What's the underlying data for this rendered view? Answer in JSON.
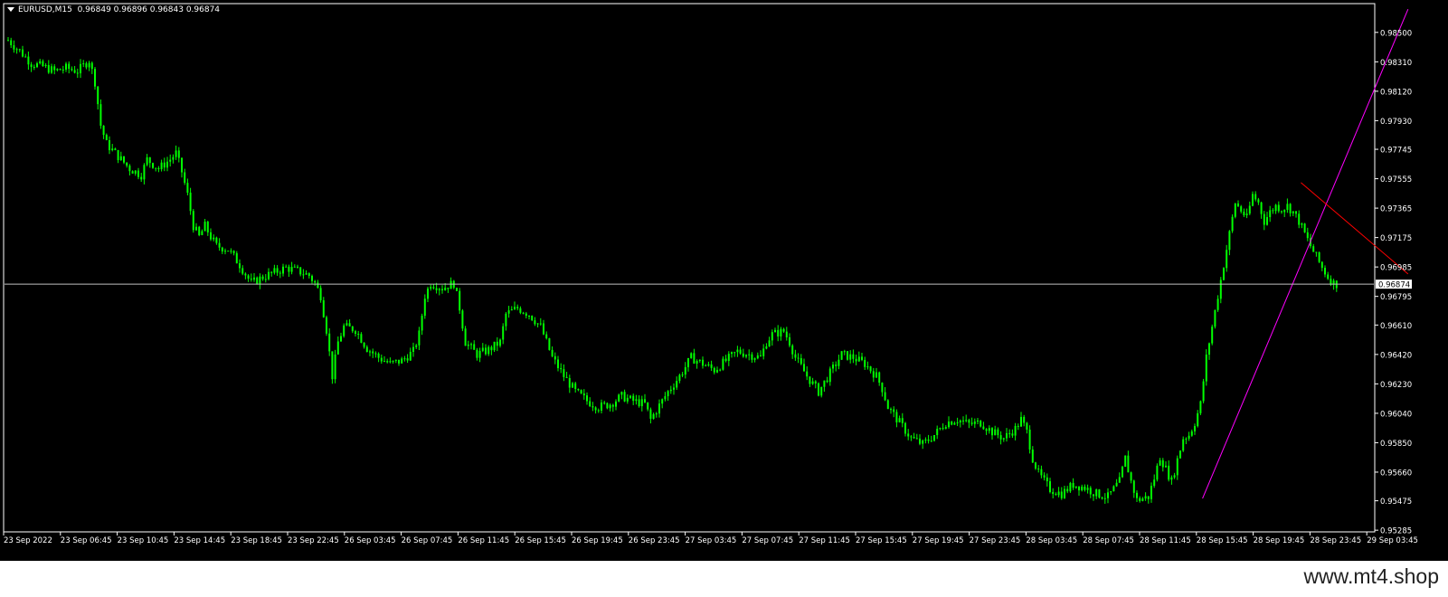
{
  "header": {
    "symbol": "EURUSD,M15",
    "ohlc": "0.96849 0.96896 0.96843 0.96874"
  },
  "watermark": "www.mt4.shop",
  "colors": {
    "background": "#000000",
    "candles": "#00ff00",
    "axis": "#ffffff",
    "price_line": "#c0c0c0",
    "trendline_up": "#ff00ff",
    "trendline_down": "#ff0000"
  },
  "chart_data": {
    "type": "line",
    "symbol": "EURUSD",
    "timeframe": "M15",
    "current_price": 0.96874,
    "current_price_label": "0.96874",
    "grid": false,
    "ylim": [
      0.9528,
      0.9868
    ],
    "y_ticks": [
      "0.98500",
      "0.98310",
      "0.98120",
      "0.97930",
      "0.97745",
      "0.97555",
      "0.97365",
      "0.97175",
      "0.96985",
      "0.96795",
      "0.96610",
      "0.96420",
      "0.96230",
      "0.96040",
      "0.95850",
      "0.95660",
      "0.95475",
      "0.95285"
    ],
    "x_ticks": [
      "23 Sep 2022",
      "23 Sep 06:45",
      "23 Sep 10:45",
      "23 Sep 14:45",
      "23 Sep 18:45",
      "23 Sep 22:45",
      "26 Sep 03:45",
      "26 Sep 07:45",
      "26 Sep 11:45",
      "26 Sep 15:45",
      "26 Sep 19:45",
      "26 Sep 23:45",
      "27 Sep 03:45",
      "27 Sep 07:45",
      "27 Sep 11:45",
      "27 Sep 15:45",
      "27 Sep 19:45",
      "27 Sep 23:45",
      "28 Sep 03:45",
      "28 Sep 07:45",
      "28 Sep 11:45",
      "28 Sep 15:45",
      "28 Sep 19:45",
      "28 Sep 23:45",
      "29 Sep 03:45"
    ],
    "series": [
      {
        "values": [
          [
            0,
            0.9845
          ],
          [
            4,
            0.9838
          ],
          [
            8,
            0.983
          ],
          [
            12,
            0.9828
          ],
          [
            16,
            0.9825
          ],
          [
            20,
            0.9827
          ],
          [
            24,
            0.9825
          ],
          [
            28,
            0.9832
          ],
          [
            30,
            0.9818
          ],
          [
            32,
            0.979
          ],
          [
            34,
            0.9778
          ],
          [
            38,
            0.977
          ],
          [
            42,
            0.9762
          ],
          [
            46,
            0.9758
          ],
          [
            48,
            0.9768
          ],
          [
            52,
            0.9762
          ],
          [
            56,
            0.9768
          ],
          [
            58,
            0.9772
          ],
          [
            60,
            0.976
          ],
          [
            62,
            0.9745
          ],
          [
            64,
            0.9725
          ],
          [
            66,
            0.9718
          ],
          [
            68,
            0.9725
          ],
          [
            70,
            0.9718
          ],
          [
            72,
            0.9712
          ],
          [
            76,
            0.971
          ],
          [
            80,
            0.97
          ],
          [
            84,
            0.9688
          ],
          [
            88,
            0.9692
          ],
          [
            92,
            0.9695
          ],
          [
            96,
            0.9698
          ],
          [
            100,
            0.9696
          ],
          [
            104,
            0.9693
          ],
          [
            106,
            0.9688
          ],
          [
            108,
            0.968
          ],
          [
            110,
            0.9658
          ],
          [
            112,
            0.9628
          ],
          [
            114,
            0.965
          ],
          [
            116,
            0.966
          ],
          [
            120,
            0.9658
          ],
          [
            124,
            0.9646
          ],
          [
            128,
            0.964
          ],
          [
            132,
            0.9636
          ],
          [
            136,
            0.9638
          ],
          [
            140,
            0.9644
          ],
          [
            142,
            0.9655
          ],
          [
            144,
            0.968
          ],
          [
            146,
            0.9688
          ],
          [
            150,
            0.9685
          ],
          [
            154,
            0.9688
          ],
          [
            156,
            0.9672
          ],
          [
            158,
            0.965
          ],
          [
            162,
            0.9642
          ],
          [
            166,
            0.9645
          ],
          [
            170,
            0.965
          ],
          [
            172,
            0.9668
          ],
          [
            176,
            0.9672
          ],
          [
            180,
            0.9668
          ],
          [
            184,
            0.966
          ],
          [
            188,
            0.964
          ],
          [
            192,
            0.9628
          ],
          [
            196,
            0.9618
          ],
          [
            200,
            0.9612
          ],
          [
            204,
            0.9608
          ],
          [
            208,
            0.961
          ],
          [
            212,
            0.9615
          ],
          [
            216,
            0.9612
          ],
          [
            220,
            0.961
          ],
          [
            222,
            0.96
          ],
          [
            224,
            0.9606
          ],
          [
            228,
            0.9618
          ],
          [
            232,
            0.9628
          ],
          [
            236,
            0.964
          ],
          [
            240,
            0.9636
          ],
          [
            244,
            0.9632
          ],
          [
            248,
            0.9638
          ],
          [
            252,
            0.9644
          ],
          [
            256,
            0.9642
          ],
          [
            260,
            0.964
          ],
          [
            262,
            0.965
          ],
          [
            264,
            0.9655
          ],
          [
            268,
            0.9657
          ],
          [
            270,
            0.965
          ],
          [
            272,
            0.964
          ],
          [
            276,
            0.9628
          ],
          [
            280,
            0.9618
          ],
          [
            284,
            0.963
          ],
          [
            288,
            0.9642
          ],
          [
            292,
            0.964
          ],
          [
            296,
            0.9636
          ],
          [
            300,
            0.9628
          ],
          [
            302,
            0.962
          ],
          [
            304,
            0.9608
          ],
          [
            308,
            0.9598
          ],
          [
            312,
            0.9588
          ],
          [
            316,
            0.9584
          ],
          [
            320,
            0.959
          ],
          [
            324,
            0.9598
          ],
          [
            328,
            0.96
          ],
          [
            332,
            0.9597
          ],
          [
            336,
            0.9598
          ],
          [
            340,
            0.9592
          ],
          [
            344,
            0.9588
          ],
          [
            348,
            0.9594
          ],
          [
            350,
            0.96
          ],
          [
            352,
            0.9592
          ],
          [
            354,
            0.9575
          ],
          [
            356,
            0.9565
          ],
          [
            360,
            0.9555
          ],
          [
            364,
            0.9552
          ],
          [
            368,
            0.9558
          ],
          [
            372,
            0.9556
          ],
          [
            376,
            0.9552
          ],
          [
            380,
            0.955
          ],
          [
            384,
            0.956
          ],
          [
            386,
            0.9575
          ],
          [
            388,
            0.956
          ],
          [
            390,
            0.9548
          ],
          [
            394,
            0.955
          ],
          [
            396,
            0.9562
          ],
          [
            398,
            0.9576
          ],
          [
            400,
            0.9568
          ],
          [
            402,
            0.956
          ],
          [
            404,
            0.9574
          ],
          [
            406,
            0.9588
          ],
          [
            408,
            0.959
          ],
          [
            410,
            0.9598
          ],
          [
            412,
            0.961
          ],
          [
            414,
            0.964
          ],
          [
            416,
            0.966
          ],
          [
            418,
            0.968
          ],
          [
            420,
            0.97
          ],
          [
            422,
            0.972
          ],
          [
            424,
            0.974
          ],
          [
            426,
            0.9735
          ],
          [
            428,
            0.973
          ],
          [
            430,
            0.9745
          ],
          [
            432,
            0.974
          ],
          [
            434,
            0.9728
          ],
          [
            436,
            0.9734
          ],
          [
            438,
            0.9738
          ],
          [
            440,
            0.9736
          ],
          [
            442,
            0.9738
          ],
          [
            444,
            0.9734
          ],
          [
            446,
            0.9728
          ],
          [
            448,
            0.972
          ],
          [
            450,
            0.9712
          ],
          [
            452,
            0.9705
          ],
          [
            454,
            0.9698
          ],
          [
            456,
            0.9692
          ],
          [
            458,
            0.9688
          ],
          [
            460,
            0.9687
          ]
        ]
      }
    ],
    "trendlines": [
      {
        "color": "#ff00ff",
        "from": [
          413,
          0.9549
        ],
        "to": [
          484,
          0.9865
        ]
      },
      {
        "color": "#ff0000",
        "from": [
          447,
          0.9753
        ],
        "to": [
          484,
          0.9694
        ]
      }
    ]
  }
}
